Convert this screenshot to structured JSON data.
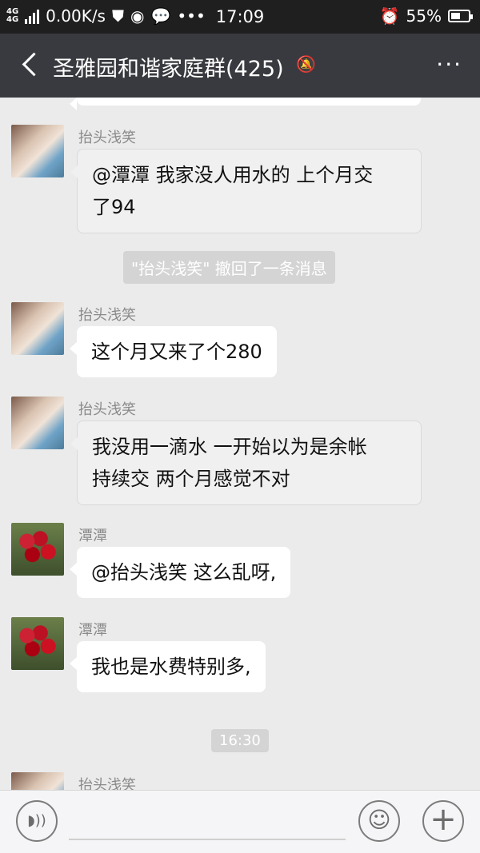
{
  "status_bar": {
    "network": "4G",
    "network2": "4G",
    "speed": "0.00K/s",
    "time": "17:09",
    "battery": "55%",
    "battery_level": 0.55,
    "icons": [
      "signal-icon",
      "shield-icon",
      "weibo-icon",
      "chat-icon",
      "more-dots-icon",
      "alarm-icon",
      "battery-icon"
    ]
  },
  "header": {
    "title": "圣雅园和谐家庭群(425)",
    "mute_icon": "muted-bell-icon",
    "more_label": "···"
  },
  "messages": [
    {
      "sender": "抬头浅笑",
      "text_line1": "@潭潭  我家没人用水的 上个月交",
      "text_line2": "了94",
      "avatar": "person-photo"
    },
    {
      "system": "\"抬头浅笑\" 撤回了一条消息"
    },
    {
      "sender": "抬头浅笑",
      "text": "这个月又来了个280",
      "avatar": "person-photo"
    },
    {
      "sender": "抬头浅笑",
      "text_line1": "我没用一滴水 一开始以为是余帐",
      "text_line2": "持续交 两个月感觉不对",
      "avatar": "person-photo"
    },
    {
      "sender": "潭潭",
      "text": "@抬头浅笑  这么乱呀,",
      "avatar": "roses-photo"
    },
    {
      "sender": "潭潭",
      "text": "我也是水费特别多,",
      "avatar": "roses-photo"
    },
    {
      "time": "16:30"
    },
    {
      "sender": "抬头浅笑",
      "avatar": "person-photo"
    }
  ],
  "input_bar": {
    "voice_icon": "voice-icon",
    "emoji_icon": "emoji-icon",
    "plus_icon": "plus-icon",
    "voice_glyph": "◗))",
    "emoji_glyph": "☺",
    "plus_glyph": "+"
  }
}
